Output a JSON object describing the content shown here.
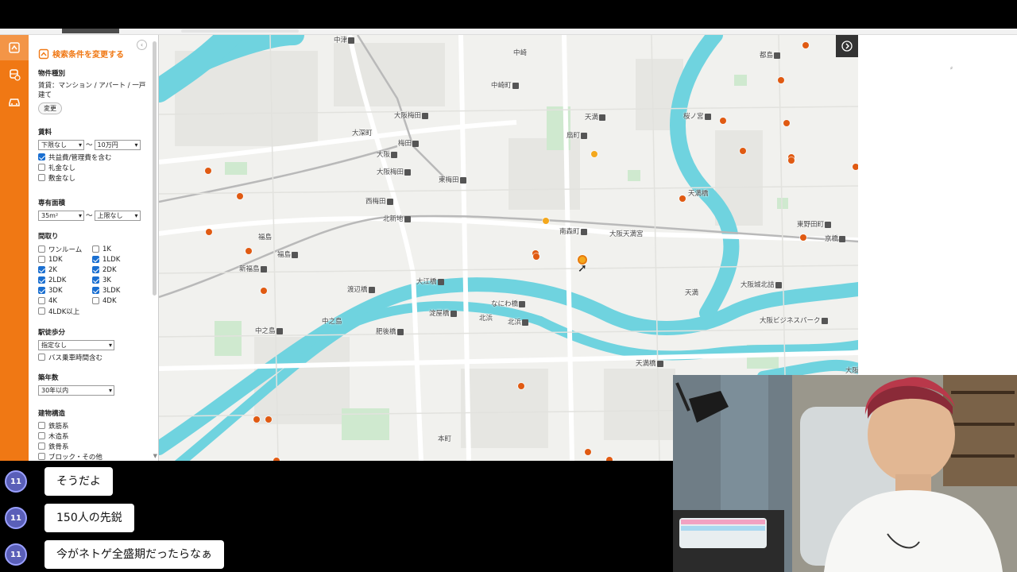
{
  "sidebar": {
    "header": "検索条件を変更する",
    "property_type": {
      "title": "物件種別",
      "value": "賃貸：マンション / アパート / 一戸建て",
      "change_label": "変更"
    },
    "rent": {
      "title": "賃料",
      "min": "下限なし",
      "separator": "〜",
      "max": "10万円",
      "options": [
        {
          "label": "共益費/管理費を含む",
          "checked": true
        },
        {
          "label": "礼金なし",
          "checked": false
        },
        {
          "label": "敷金なし",
          "checked": false
        }
      ]
    },
    "area": {
      "title": "専有面積",
      "min": "35m²",
      "separator": "〜",
      "max": "上限なし"
    },
    "layout": {
      "title": "間取り",
      "options": [
        {
          "label": "ワンルーム",
          "checked": false
        },
        {
          "label": "1K",
          "checked": false
        },
        {
          "label": "1DK",
          "checked": false
        },
        {
          "label": "1LDK",
          "checked": true
        },
        {
          "label": "2K",
          "checked": true
        },
        {
          "label": "2DK",
          "checked": true
        },
        {
          "label": "2LDK",
          "checked": true
        },
        {
          "label": "3K",
          "checked": true
        },
        {
          "label": "3DK",
          "checked": true
        },
        {
          "label": "3LDK",
          "checked": true
        },
        {
          "label": "4K",
          "checked": false
        },
        {
          "label": "4DK",
          "checked": false
        },
        {
          "label": "4LDK以上",
          "checked": false
        }
      ]
    },
    "walk": {
      "title": "駅徒歩分",
      "value": "指定なし",
      "bus_label": "バス乗車時間含む",
      "bus_checked": false
    },
    "age": {
      "title": "築年数",
      "value": "30年以内"
    },
    "structure": {
      "title": "建物構造",
      "options": [
        {
          "label": "鉄筋系",
          "checked": false
        },
        {
          "label": "木造系",
          "checked": false
        },
        {
          "label": "鉄骨系",
          "checked": false
        },
        {
          "label": "ブロック・その他",
          "checked": false
        }
      ]
    }
  },
  "map": {
    "labels": {
      "nakatsu": "中津",
      "nakazaki": "中崎",
      "nakazakicho": "中崎町",
      "miyakojima": "都島",
      "osaka_umeda": "大阪梅田",
      "tenma": "天満",
      "sakuranomiya": "桜ノ宮",
      "ogimachi": "扇町",
      "daiyuka": "大深町",
      "umeda": "梅田",
      "osaka": "大阪",
      "osaka_umeda2": "大阪梅田",
      "higashi_umeda": "東梅田",
      "nishi_umeda": "西梅田",
      "kitashinchi": "北新地",
      "tenmabashi": "天満橋",
      "higashi_noda": "東野田町",
      "kyobashi": "京橋",
      "minamimorimachi": "南森町",
      "osaka_tenmangu": "大阪天満宮",
      "fukushima": "福島",
      "fukushima2": "福島",
      "shinfukushima": "新福島",
      "watanabebashi": "渡辺橋",
      "oebashi": "大江橋",
      "naniwabashi": "なにわ橋",
      "tenma2": "天満",
      "osakajo_kitazume": "大阪城北詰",
      "nakanoshima": "中之島",
      "nakanoshima2": "中之島",
      "yodoyabashi": "淀屋橋",
      "kitahama": "北浜",
      "kitahama2": "北浜",
      "higobashi": "肥後橋",
      "osaka_business_park": "大阪ビジネスパーク",
      "tenmabashi2": "天満橋",
      "honmachi": "本町",
      "osakajo": "大阪"
    }
  },
  "chat": {
    "messages": [
      {
        "badge": "11",
        "text": "そうだよ"
      },
      {
        "badge": "11",
        "text": "150人の先鋭"
      },
      {
        "badge": "11",
        "text": "今がネトゲ全盛期だったらなぁ"
      }
    ]
  },
  "right_panel": {
    "glyph": "⸗"
  },
  "icons": {
    "nav": [
      "home-icon",
      "train-icon",
      "car-icon"
    ],
    "info": "ⓘ",
    "map_control": "chevron-right-icon"
  },
  "colors": {
    "brand": "#f07814",
    "pin": "#e05a12",
    "pin_highlight": "#f4a81d",
    "river": "#6fd3df"
  }
}
